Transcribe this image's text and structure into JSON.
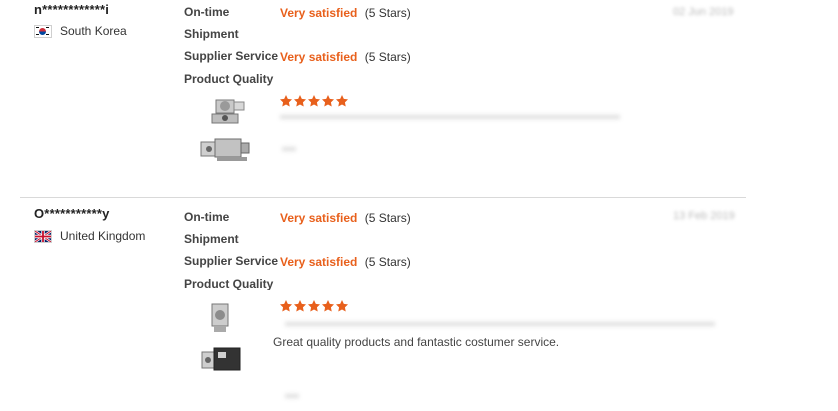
{
  "reviews": [
    {
      "buyer": "n************i",
      "country": "South Korea",
      "date": "02 Jun 2019",
      "labels": {
        "ontime": "On-time",
        "shipment": "Shipment",
        "supplier": "Supplier Service",
        "quality": "Product Quality"
      },
      "ontime_rating": "Very satisfied",
      "ontime_stars": "(5 Stars)",
      "supplier_rating": "Very satisfied",
      "supplier_stars": "(5 Stars)",
      "quality_stars": 5,
      "comment": ""
    },
    {
      "buyer": "O***********y",
      "country": "United Kingdom",
      "date": "13 Feb 2019",
      "labels": {
        "ontime": "On-time",
        "shipment": "Shipment",
        "supplier": "Supplier Service",
        "quality": "Product Quality"
      },
      "ontime_rating": "Very satisfied",
      "ontime_stars": "(5 Stars)",
      "supplier_rating": "Very satisfied",
      "supplier_stars": "(5 Stars)",
      "quality_stars": 5,
      "comment": "Great quality products and fantastic costumer service."
    }
  ],
  "colors": {
    "accent": "#e8601c",
    "divider": "#d9d9d9"
  },
  "icons": {
    "star": "star-icon",
    "product": "starter-motor-thumbnail"
  }
}
